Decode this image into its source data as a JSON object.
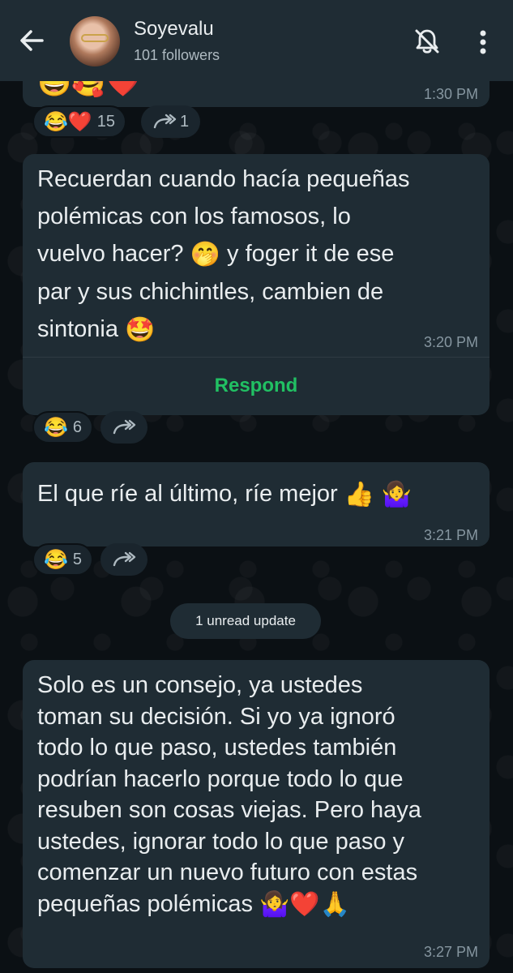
{
  "header": {
    "channel_name": "Soyevalu",
    "followers": "101 followers"
  },
  "messages": [
    {
      "id": "m0",
      "text_emojis": "😅🥰❤️",
      "time": "1:30 PM",
      "reactions": {
        "emojis": "😂❤️",
        "count": "15"
      },
      "forwards": "1"
    },
    {
      "id": "m1",
      "lines": [
        "Recuerdan cuando hacía pequeñas",
        "polémicas con los famosos, lo",
        "vuelvo hacer?",
        "par y sus chichintles, cambien de",
        "sintonia"
      ],
      "line3_emoji": "🤭",
      "line3_rest": " y foger it de ese",
      "line5_emoji": "🤩",
      "time": "3:20 PM",
      "respond_label": "Respond",
      "reactions": {
        "emojis": "😂",
        "count": "6"
      }
    },
    {
      "id": "m2",
      "text": "El que ríe al último, ríe mejor",
      "emojis": "👍 🤷‍♀️",
      "time": "3:21 PM",
      "reactions": {
        "emojis": "😂",
        "count": "5"
      }
    },
    {
      "id": "m3",
      "lines": [
        "Solo es un consejo, ya ustedes",
        "toman su decisión. Si yo ya ignoró",
        "todo lo que paso, ustedes también",
        "podrían hacerlo porque todo lo que",
        "resuben son cosas viejas. Pero haya",
        "ustedes, ignorar todo lo que paso y",
        "comenzar un nuevo futuro con estas",
        "pequeñas polémicas"
      ],
      "end_emojis": "🤷‍♀️❤️🙏",
      "time": "3:27 PM"
    }
  ],
  "unread_chip": "1 unread update",
  "icons": {
    "back": "arrow-left-icon",
    "mute": "bell-off-icon",
    "menu": "more-vertical-icon",
    "forward": "forward-arrow-icon"
  },
  "colors": {
    "header_bg": "#1f2c34",
    "bubble_bg": "#1f2c34",
    "chat_bg": "#0b1014",
    "accent_green": "#21c063",
    "text_primary": "#e9edef",
    "text_secondary": "#8696a0"
  }
}
